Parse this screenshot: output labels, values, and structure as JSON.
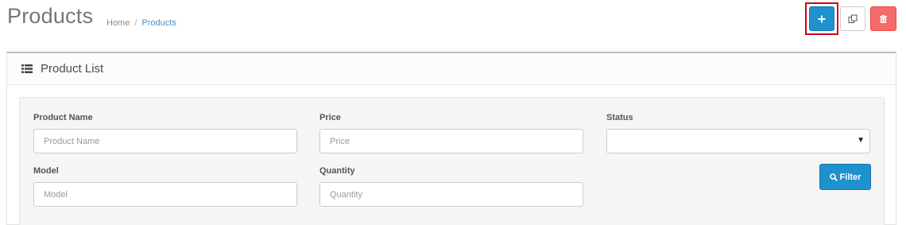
{
  "header": {
    "title": "Products",
    "breadcrumb": [
      {
        "label": "Home"
      },
      {
        "label": "Products"
      }
    ],
    "breadcrumb_separator": "/"
  },
  "toolbar": {
    "add_icon": "plus-icon",
    "copy_icon": "copy-icon",
    "delete_icon": "trash-icon",
    "colors": {
      "primary": "#1e91cf",
      "danger": "#f56b6b",
      "highlight": "#d0021b"
    }
  },
  "panel": {
    "title": "Product List",
    "icon": "list-icon"
  },
  "filter": {
    "product_name": {
      "label": "Product Name",
      "placeholder": "Product Name",
      "value": ""
    },
    "price": {
      "label": "Price",
      "placeholder": "Price",
      "value": ""
    },
    "status": {
      "label": "Status",
      "selected": ""
    },
    "model": {
      "label": "Model",
      "placeholder": "Model",
      "value": ""
    },
    "quantity": {
      "label": "Quantity",
      "placeholder": "Quantity",
      "value": ""
    },
    "filter_button": {
      "label": "Filter",
      "icon": "search-icon"
    }
  }
}
